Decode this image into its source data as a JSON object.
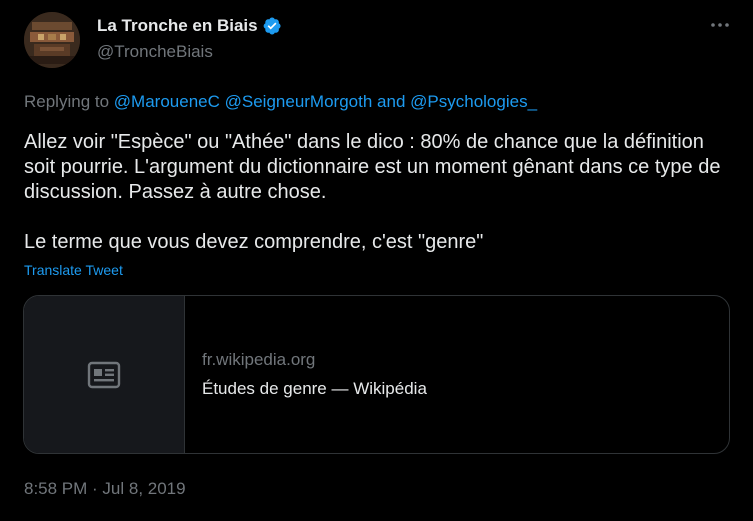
{
  "author": {
    "display_name": "La Tronche en Biais",
    "handle": "@TroncheBiais",
    "avatar_icon": "avatar-image",
    "verified_icon": "verified-badge-icon"
  },
  "more_icon": "more-options-icon",
  "reply_context": {
    "prefix": "Replying to",
    "mention_1": "@MarouenеC",
    "mention_2": "@SeigneurMorgoth",
    "conjunction": "and",
    "mention_3": "@Psychologies_"
  },
  "body": {
    "paragraph_1": "Allez voir \"Espèce\" ou \"Athée\" dans le dico : 80% de chance que la définition soit pourrie. L'argument du dictionnaire est un moment gênant dans ce type de discussion. Passez à autre chose.",
    "paragraph_2": "Le terme que vous devez comprendre, c'est \"genre\""
  },
  "translate_label": "Translate Tweet",
  "link_card": {
    "domain": "fr.wikipedia.org",
    "title": "Études de genre — Wikipédia",
    "thumb_icon": "article-icon"
  },
  "timestamp": "8:58 PM · Jul 8, 2019",
  "colors": {
    "background": "#000000",
    "primary_text": "#e7e9ea",
    "secondary_text": "#71767b",
    "accent": "#1d9bf0",
    "border": "#2f3336"
  }
}
